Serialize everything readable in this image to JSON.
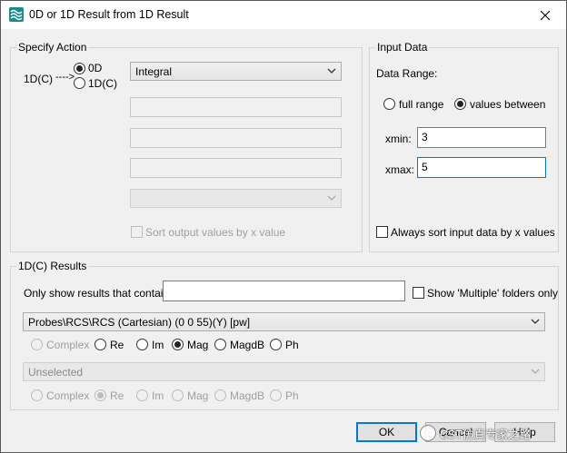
{
  "window": {
    "title": "0D or 1D Result from 1D Result"
  },
  "specify_action": {
    "group_title": "Specify Action",
    "source_label": "1D(C)",
    "arrow_text": "---->",
    "radio_0d": "0D",
    "radio_1dc": "1D(C)",
    "operation_combo": "Integral",
    "sort_output_label": "Sort output values by x value"
  },
  "input_data": {
    "group_title": "Input Data",
    "data_range_label": "Data Range:",
    "full_range_label": "full range",
    "values_between_label": "values between",
    "xmin_label": "xmin:",
    "xmin_value": "3",
    "xmax_label": "xmax:",
    "xmax_value": "5",
    "always_sort_label": "Always sort input data by x values"
  },
  "results": {
    "group_title": "1D(C) Results",
    "filter_label": "Only show results that contain:",
    "filter_value": "",
    "show_multiple_label": "Show 'Multiple' folders only",
    "result_combo": "Probes\\RCS\\RCS (Cartesian) (0 0 55)(Y) [pw]",
    "mode_options": [
      "Complex",
      "Re",
      "Im",
      "Mag",
      "MagdB",
      "Ph"
    ],
    "second_combo": "Unselected",
    "mode_options_2": [
      "Complex",
      "Re",
      "Im",
      "Mag",
      "MagdB",
      "Ph"
    ]
  },
  "buttons": {
    "ok": "OK",
    "cancel": "Cancel",
    "help": "Help"
  },
  "watermark": {
    "text": "CST仿真专家之路"
  },
  "colors": {
    "accent": "#0078d7",
    "icon_bg": "#1a8a8a"
  }
}
